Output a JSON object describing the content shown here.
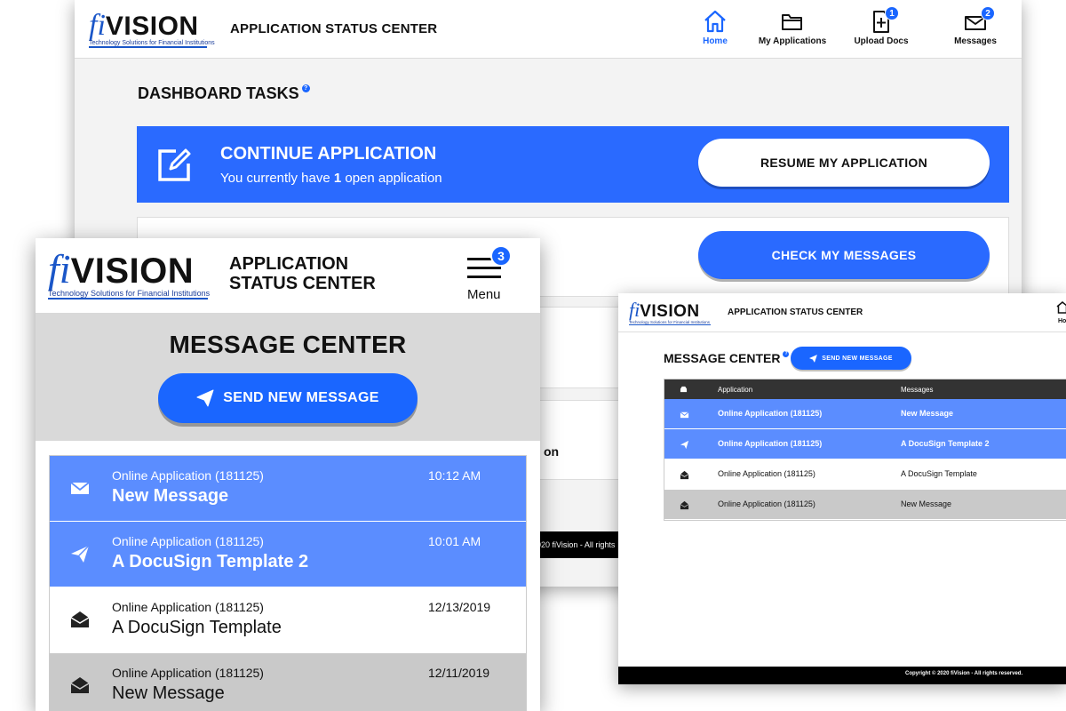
{
  "brand": {
    "logo_fi": "fi",
    "logo_vision": "VISION",
    "tagline": "Technology Solutions for Financial Institutions",
    "primary_color": "#1a66ff",
    "unread_row_color": "#5b8dff"
  },
  "desktop": {
    "header_title": "APPLICATION STATUS CENTER",
    "nav": [
      {
        "label": "Home",
        "icon": "home-icon",
        "active": true
      },
      {
        "label": "My Applications",
        "icon": "folder-icon"
      },
      {
        "label": "Upload Docs",
        "icon": "upload-doc-icon",
        "badge": "1"
      },
      {
        "label": "Messages",
        "icon": "envelope-icon",
        "badge": "2"
      }
    ],
    "dashboard_title": "DASHBOARD TASKS",
    "continue_title": "CONTINUE APPLICATION",
    "continue_sub_pre": "You currently have ",
    "continue_sub_count": "1",
    "continue_sub_post": " open application",
    "resume_label": "RESUME MY APPLICATION",
    "check_messages_label": "CHECK MY MESSAGES",
    "row4_fragment": "on",
    "copyright_fragment": "020 fiVision - All rights"
  },
  "mobile": {
    "header_title_line1": "APPLICATION",
    "header_title_line2": "STATUS CENTER",
    "menu_label": "Menu",
    "menu_badge": "3",
    "page_title": "MESSAGE CENTER",
    "send_label": "SEND NEW MESSAGE",
    "messages": [
      {
        "app": "Online Application (181125)",
        "subject": "New Message",
        "time": "10:12 AM",
        "state": "unread",
        "icon": "envelope-closed-icon"
      },
      {
        "app": "Online Application (181125)",
        "subject": "A DocuSign Template 2",
        "time": "10:01 AM",
        "state": "unread",
        "icon": "paper-plane-icon"
      },
      {
        "app": "Online Application (181125)",
        "subject": "A DocuSign Template",
        "time": "12/13/2019",
        "state": "read",
        "icon": "envelope-open-icon"
      },
      {
        "app": "Online Application (181125)",
        "subject": "New Message",
        "time": "12/11/2019",
        "state": "alt",
        "icon": "envelope-open-icon"
      }
    ]
  },
  "midscreen": {
    "header_title": "APPLICATION STATUS CENTER",
    "home_label": "Ho",
    "page_title": "MESSAGE CENTER",
    "send_label": "SEND NEW MESSAGE",
    "table_headers": {
      "application": "Application",
      "messages": "Messages"
    },
    "rows": [
      {
        "app": "Online Application (181125)",
        "message": "New Message",
        "state": "unread",
        "icon": "envelope-closed-icon"
      },
      {
        "app": "Online Application (181125)",
        "message": "A DocuSign Template 2",
        "state": "unread",
        "icon": "paper-plane-icon"
      },
      {
        "app": "Online Application (181125)",
        "message": "A DocuSign Template",
        "state": "read",
        "icon": "envelope-open-icon"
      },
      {
        "app": "Online Application (181125)",
        "message": "New Message",
        "state": "alt",
        "icon": "envelope-open-icon"
      }
    ],
    "copyright": "Copyright © 2020 fiVision - All rights reserved."
  }
}
